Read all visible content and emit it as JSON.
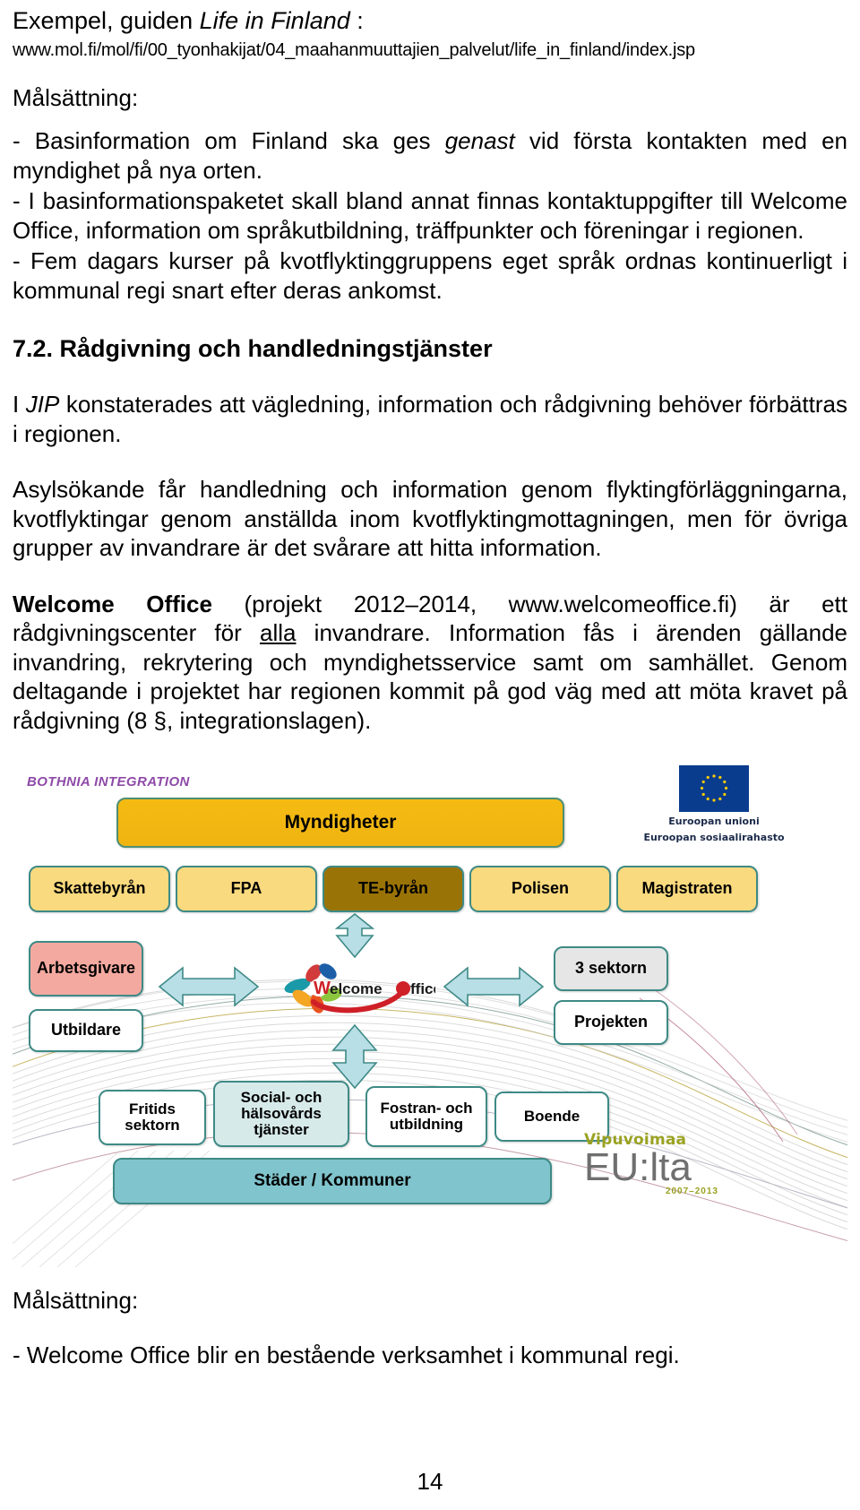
{
  "header": {
    "title_prefix": "Exempel, guiden ",
    "title_italic": "Life in Finland",
    "title_suffix": " :",
    "url": "www.mol.fi/mol/fi/00_tyonhakijat/04_maahanmuuttajien_palvelut/life_in_finland/index.jsp"
  },
  "goal_label_top": "Målsättning:",
  "bullets": [
    {
      "pre": "- Basinformation om Finland ska ges ",
      "ital": "genast",
      "post": " vid första kontakten med en myndighet på nya orten."
    },
    {
      "pre": "- I basinformationspaketet skall bland annat finnas kontaktuppgifter till Welcome Office, information om språkutbildning, träffpunkter och föreningar i regionen.",
      "ital": "",
      "post": ""
    },
    {
      "pre": "- Fem dagars kurser på kvotflyktinggruppens eget språk ordnas kontinuerligt i kommunal regi snart efter deras ankomst.",
      "ital": "",
      "post": ""
    }
  ],
  "section": {
    "number_title": "7.2. Rådgivning och handledningstjänster"
  },
  "paragraphs": {
    "p1_pre": "I ",
    "p1_ital": "JIP",
    "p1_post": " konstaterades att vägledning, information och rådgivning behöver förbättras i regionen.",
    "p2": "Asylsökande får handledning och information genom flyktingförläggningarna, kvotflyktingar genom anställda inom kvotflyktingmottagningen, men för övriga grupper av invandrare är det svårare att hitta information.",
    "p3_bold": "Welcome Office",
    "p3_a": " (projekt 2012–2014, www.welcomeoffice.fi) är ett rådgivningscenter för ",
    "p3_ul": "alla",
    "p3_b": " invandrare. Information fås i ärenden gällande invandring, rekrytering och myndighetsservice samt om samhället. Genom deltagande i projektet har regionen kommit på god väg med att möta kravet på rådgivning (8 §, integrationslagen)."
  },
  "diagram": {
    "brand": "BOTHNIA INTEGRATION",
    "authorities_header": "Myndigheter",
    "authorities": [
      "Skattebyrån",
      "FPA",
      "TE-byrån",
      "Polisen",
      "Magistraten"
    ],
    "left_nodes": [
      "Arbetsgivare",
      "Utbildare"
    ],
    "right_nodes": [
      "3 sektorn",
      "Projekten"
    ],
    "center_logo": "Welcome Office",
    "bottom_nodes": [
      "Fritids sektorn",
      "Social- och hälsovårds tjänster",
      "Fostran- och utbildning",
      "Boende"
    ],
    "municipalities": "Städer / Kommuner",
    "eu_logo": {
      "line1": "Euroopan unioni",
      "line2": "Euroopan sosiaalirahasto"
    },
    "vipuvoimaa": {
      "line1": "Vipuvoimaa",
      "line2": "EU:lta",
      "years": "2007–2013"
    },
    "colors": {
      "authorities_header_bg": "#f0b411",
      "authorities_bg": "#fada7e",
      "te_highlight_bg": "#9a7306",
      "employer_bg": "#f4a9a0",
      "third_sector_bg": "#e6e6e6",
      "social_bg": "#d7eaea",
      "municipal_bg": "#80c4cd",
      "node_border": "#3e8a86",
      "arrow_fill": "#b8dee6",
      "brand_text": "#8e4aa8",
      "eu_flag_blue": "#0a3c8e",
      "vipu_olive": "#9aa221"
    }
  },
  "footer": {
    "goal_label": "Målsättning:",
    "goal_line": "- Welcome Office blir en bestående verksamhet i kommunal regi.",
    "page_number": "14"
  }
}
